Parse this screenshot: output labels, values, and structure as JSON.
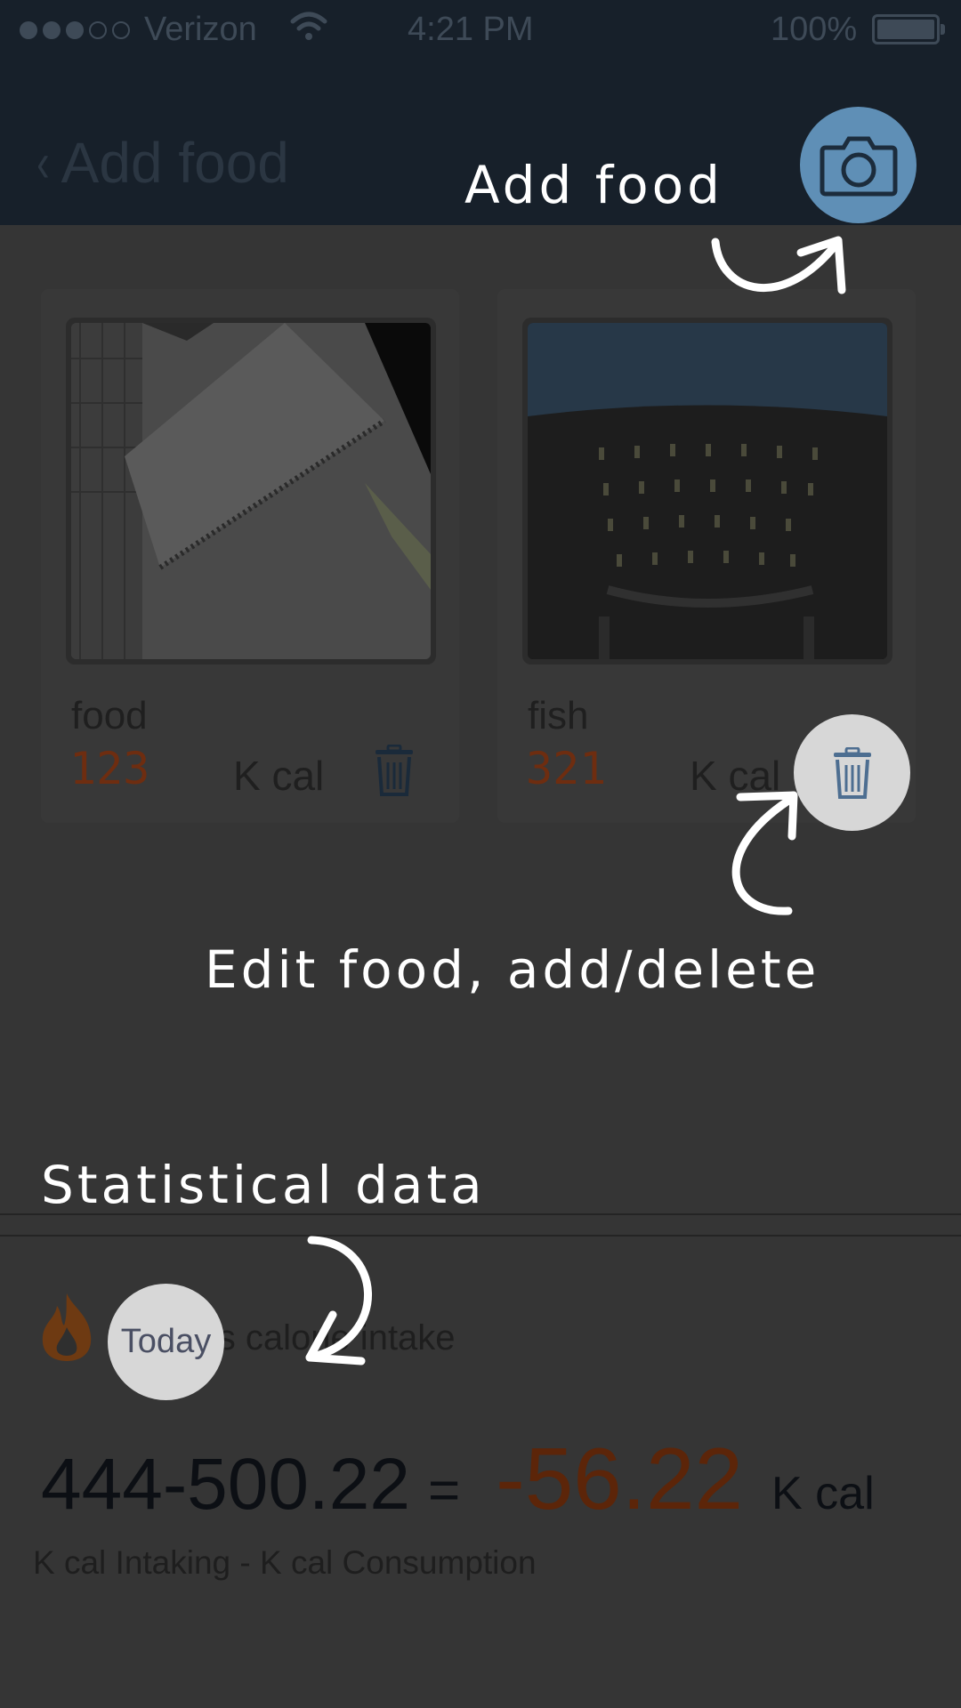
{
  "status_bar": {
    "carrier": "Verizon",
    "time": "4:21 PM",
    "battery": "100%",
    "signal_icon": "signal-dots-icon",
    "wifi_icon": "wifi-icon"
  },
  "nav": {
    "back_label": "Add food",
    "back_icon": "chevron-left-icon",
    "camera_icon": "camera-icon"
  },
  "foods": [
    {
      "name": "food",
      "kcal": "123",
      "unit": "K cal"
    },
    {
      "name": "fish",
      "kcal": "321",
      "unit": "K cal"
    }
  ],
  "stats": {
    "title_tail": "s calorie intake",
    "equation_lhs": "444-500.22",
    "equals": "=",
    "result": "-56.22",
    "unit": "K cal",
    "formula": "K cal Intaking - K cal Consumption"
  },
  "tutorial": {
    "add_food": "Add food",
    "edit_food": "Edit food, add/delete",
    "statistical": "Statistical data",
    "today": "Today"
  },
  "colors": {
    "accent_blue": "#5f8fb6",
    "calorie_orange": "#6e2d10",
    "highlight": "#d7d7d7"
  }
}
